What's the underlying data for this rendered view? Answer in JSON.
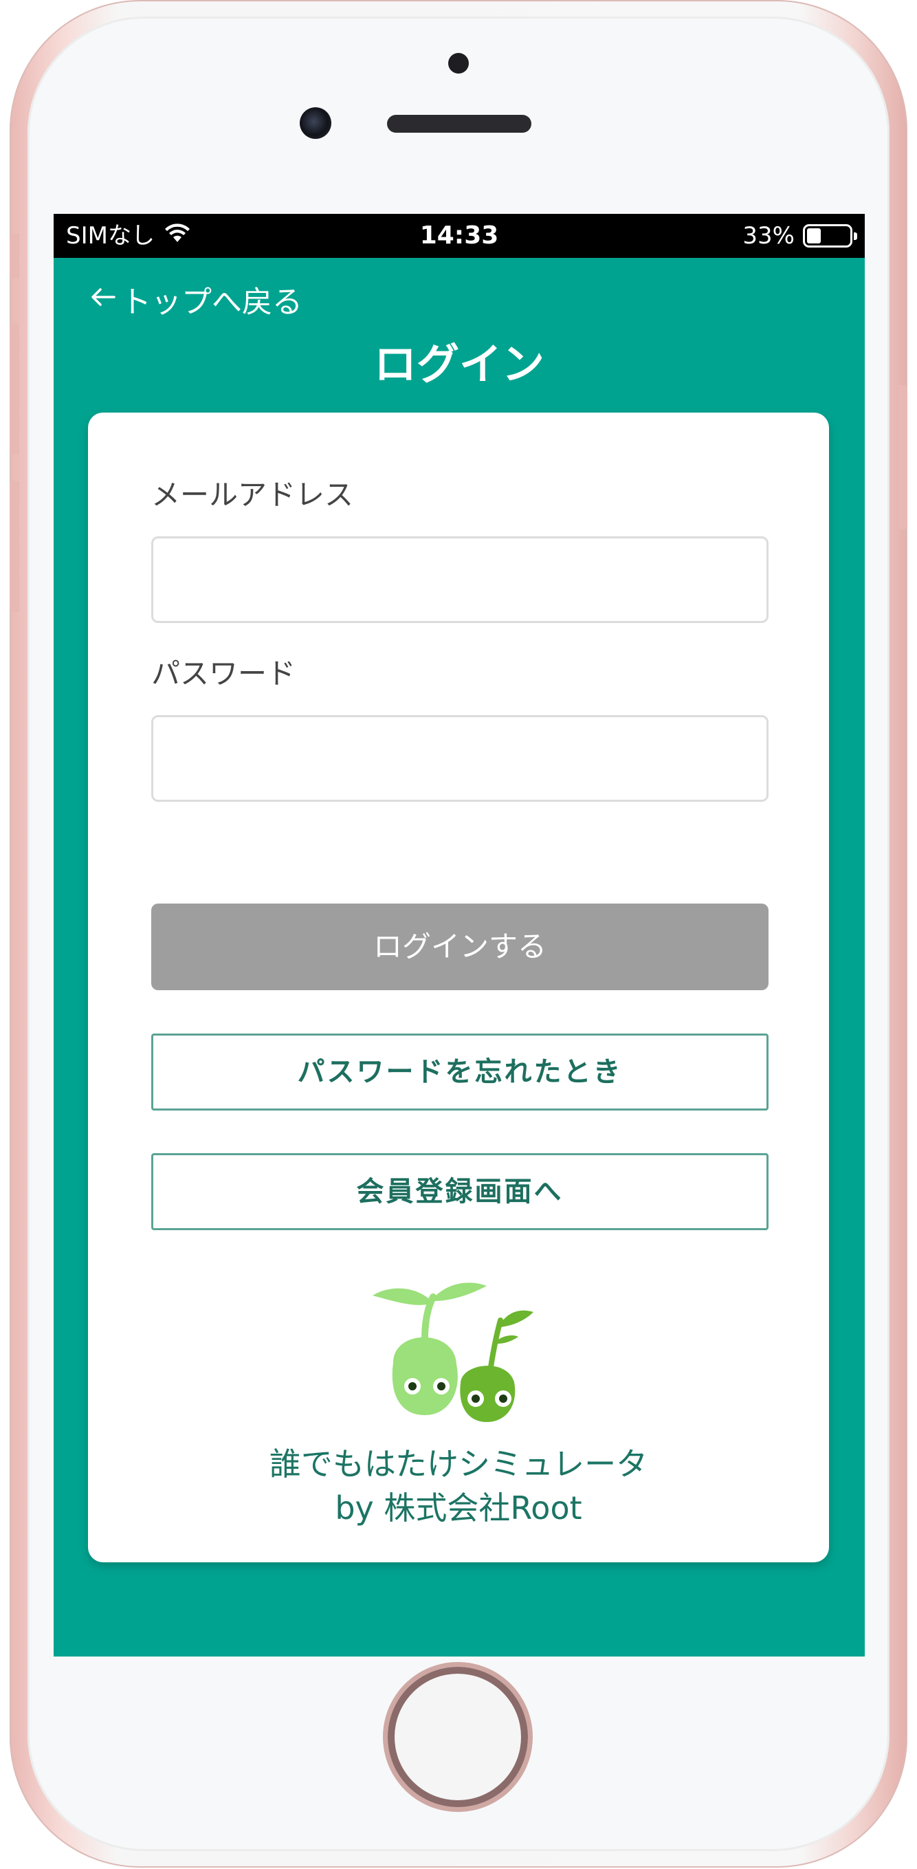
{
  "status_bar": {
    "carrier": "SIMなし",
    "time": "14:33",
    "battery_percent": "33%",
    "battery_level": 0.33
  },
  "header": {
    "back_label": "トップへ戻る",
    "title": "ログイン"
  },
  "form": {
    "email_label": "メールアドレス",
    "email_value": "",
    "password_label": "パスワード",
    "password_value": "",
    "login_button": "ログインする",
    "forgot_password_button": "パスワードを忘れたとき",
    "register_button": "会員登録画面へ"
  },
  "footer": {
    "app_name": "誰でもはたけシミュレータ",
    "company": "by 株式会社Root"
  },
  "colors": {
    "accent": "#00a390",
    "button_disabled": "#9e9e9e",
    "outline_text": "#1d6f5f",
    "mascot_light": "#9be07a",
    "mascot_dark": "#6cb52f"
  },
  "icons": {
    "back": "arrow-left-icon",
    "wifi": "wifi-icon",
    "battery": "battery-icon",
    "logo": "sprout-mascot-logo"
  }
}
